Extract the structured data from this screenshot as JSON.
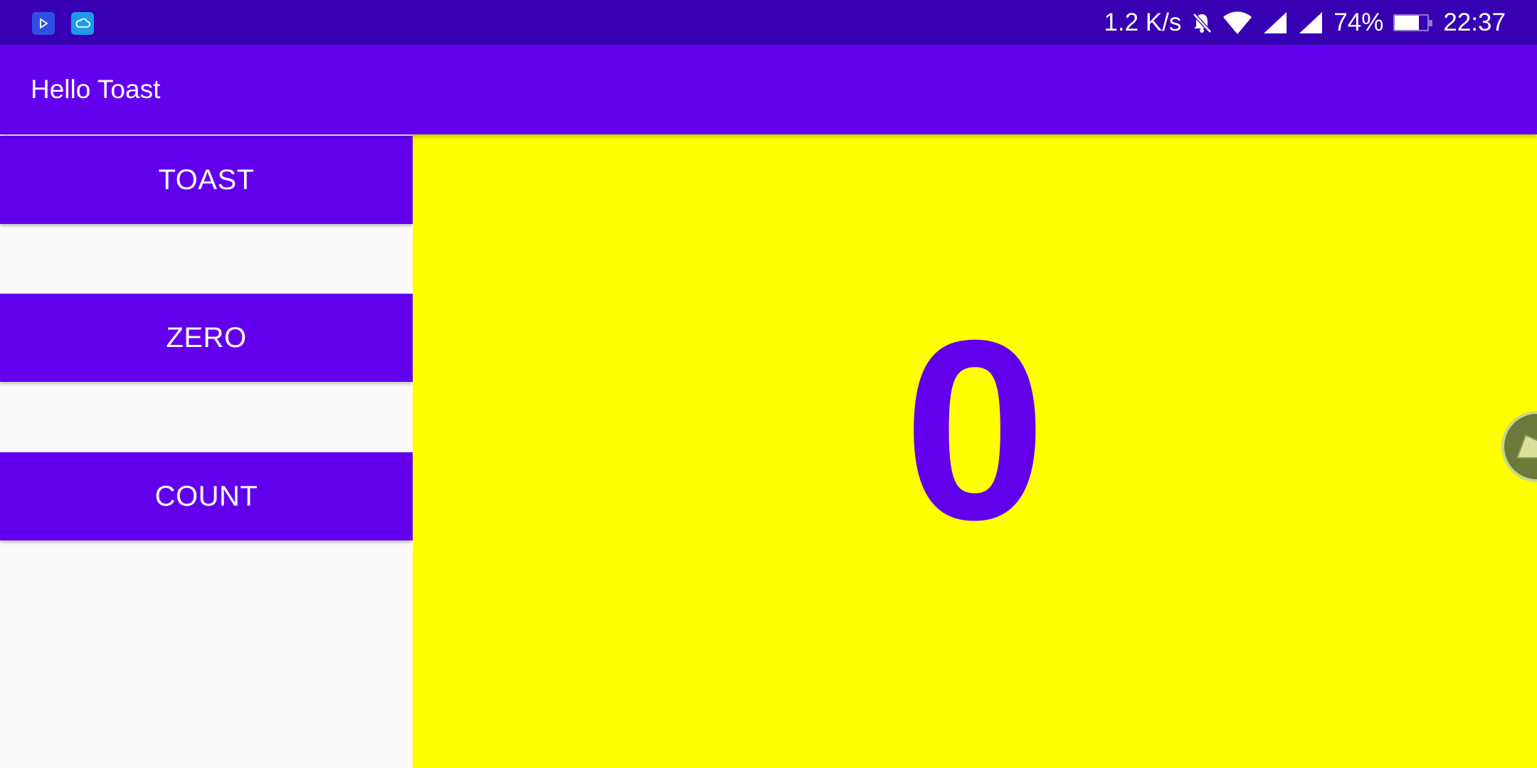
{
  "status_bar": {
    "network_speed": "1.2 K/s",
    "battery_text": "74%",
    "battery_level": 0.74,
    "time": "22:37",
    "left_icons": [
      "play-app-icon",
      "cloud-app-icon"
    ],
    "right_icons": [
      "bell-off-icon",
      "wifi-icon",
      "signal-icon",
      "signal-icon",
      "battery-icon"
    ]
  },
  "app_bar": {
    "title": "Hello Toast"
  },
  "buttons": {
    "toast_label": "TOAST",
    "zero_label": "ZERO",
    "count_label": "COUNT"
  },
  "counter": {
    "value": "0"
  },
  "colors": {
    "status_bar": "#3700b3",
    "primary": "#6200ee",
    "count_background": "#ffff00",
    "page_background": "#fafafa"
  }
}
